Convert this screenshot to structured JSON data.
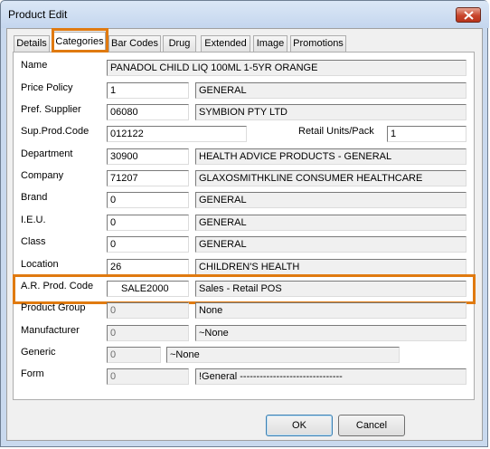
{
  "window": {
    "title": "Product Edit"
  },
  "tabs": [
    "Details",
    "Categories",
    "Bar Codes",
    "Drug",
    "Extended",
    "Image",
    "Promotions"
  ],
  "fields": {
    "name": {
      "label": "Name",
      "value": "PANADOL CHILD LIQ 100ML 1-5YR ORANGE"
    },
    "price_policy": {
      "label": "Price Policy",
      "code": "1",
      "desc": "GENERAL"
    },
    "pref_supplier": {
      "label": "Pref. Supplier",
      "code": "06080",
      "desc": "SYMBION PTY LTD"
    },
    "sup_prod_code": {
      "label": "Sup.Prod.Code",
      "value": "012122"
    },
    "retail_units": {
      "label": "Retail Units/Pack",
      "value": "1"
    },
    "department": {
      "label": "Department",
      "code": "30900",
      "desc": "HEALTH ADVICE PRODUCTS - GENERAL"
    },
    "company": {
      "label": "Company",
      "code": "71207",
      "desc": "GLAXOSMITHKLINE CONSUMER HEALTHCARE"
    },
    "brand": {
      "label": "Brand",
      "code": "0",
      "desc": "GENERAL"
    },
    "ieu": {
      "label": "I.E.U.",
      "code": "0",
      "desc": "GENERAL"
    },
    "class": {
      "label": "Class",
      "code": "0",
      "desc": "GENERAL"
    },
    "location": {
      "label": "Location",
      "code": "26",
      "desc": "CHILDREN'S HEALTH"
    },
    "ar_prod_code": {
      "label": "A.R. Prod. Code",
      "code": "SALE2000",
      "desc": "Sales - Retail POS"
    },
    "product_group": {
      "label": "Product Group",
      "code": "0",
      "desc": "None"
    },
    "manufacturer": {
      "label": "Manufacturer",
      "code": "0",
      "desc": "~None"
    },
    "generic": {
      "label": "Generic",
      "code": "0",
      "desc": "~None"
    },
    "form": {
      "label": "Form",
      "code": "0",
      "desc": "!General -------------------------------"
    }
  },
  "buttons": {
    "ok": "OK",
    "cancel": "Cancel"
  },
  "colors": {
    "highlight": "#e07a10",
    "window_frame": "#c9d9ee",
    "close": "#c8452c"
  }
}
